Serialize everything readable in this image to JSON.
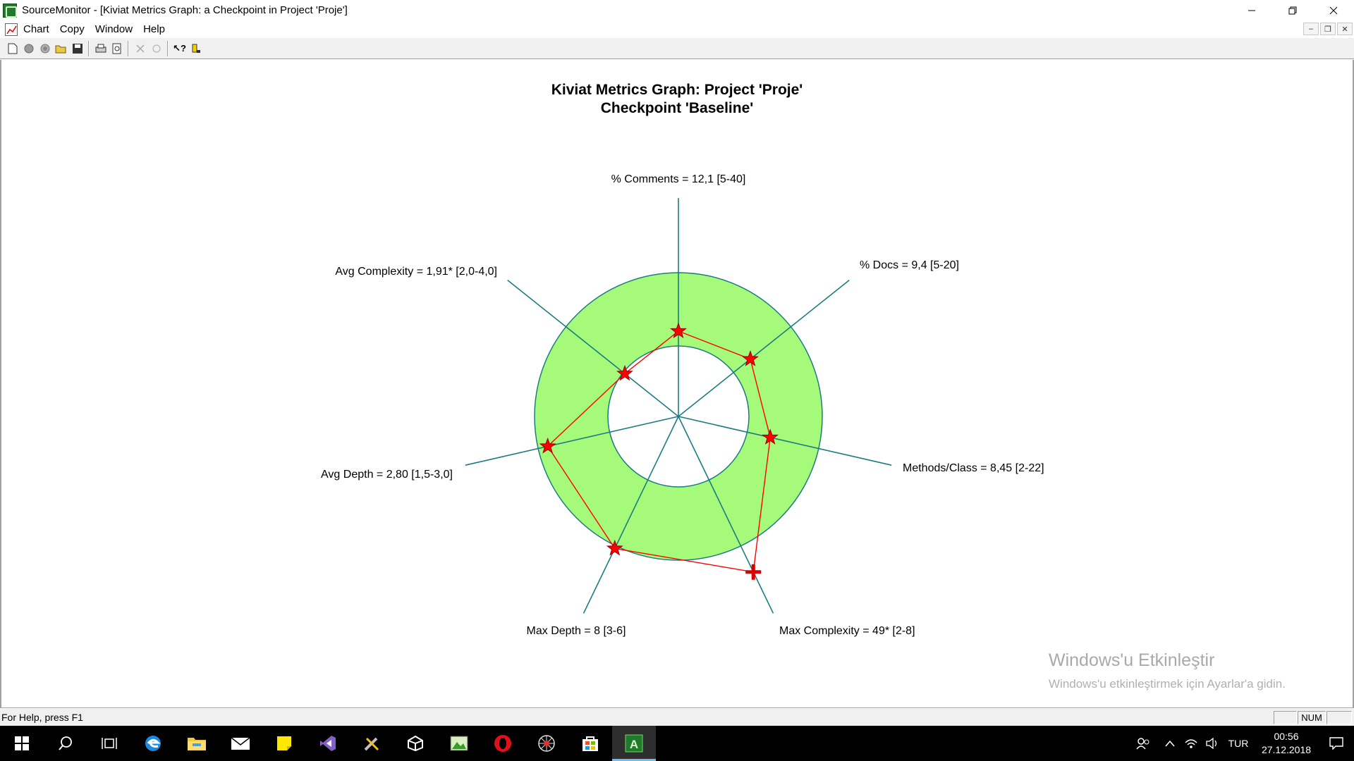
{
  "window": {
    "title": "SourceMonitor - [Kiviat Metrics Graph: a Checkpoint in Project 'Proje']",
    "icon": "sourcemonitor-app-icon",
    "controls": [
      "minimize-icon",
      "restore-icon",
      "close-icon"
    ]
  },
  "menu": {
    "items": [
      "Chart",
      "Copy",
      "Window",
      "Help"
    ],
    "mdi_controls": [
      "mdi-minimize-icon",
      "mdi-restore-icon",
      "mdi-close-icon"
    ]
  },
  "toolbar": {
    "buttons": [
      "new-icon",
      "project-icon",
      "checkpoint-icon",
      "open-icon",
      "save-icon",
      "print-icon",
      "print-preview-icon",
      "delete-icon",
      "refresh-icon",
      "context-help-icon",
      "about-icon"
    ]
  },
  "chart_data": {
    "type": "kiviat",
    "title_line1": "Kiviat Metrics Graph: Project 'Proje'",
    "title_line2": "Checkpoint 'Baseline'",
    "band_color": "#a6fa7a",
    "axis_color": "#1b7c82",
    "series_color": "#ff0000",
    "axes": [
      {
        "label": "% Comments = 12,1 [5-40]",
        "metric": "% Comments",
        "value": 12.1,
        "min": 5,
        "max": 40,
        "out_of_range": false
      },
      {
        "label": "% Docs = 9,4 [5-20]",
        "metric": "% Docs",
        "value": 9.4,
        "min": 5,
        "max": 20,
        "out_of_range": false
      },
      {
        "label": "Methods/Class = 8,45 [2-22]",
        "metric": "Methods/Class",
        "value": 8.45,
        "min": 2,
        "max": 22,
        "out_of_range": false
      },
      {
        "label": "Max Complexity = 49* [2-8]",
        "metric": "Max Complexity",
        "value": 49,
        "min": 2,
        "max": 8,
        "out_of_range": true
      },
      {
        "label": "Max Depth = 8 [3-6]",
        "metric": "Max Depth",
        "value": 8,
        "min": 3,
        "max": 6,
        "out_of_range": true
      },
      {
        "label": "Avg Depth = 2,80 [1,5-3,0]",
        "metric": "Avg Depth",
        "value": 2.8,
        "min": 1.5,
        "max": 3.0,
        "out_of_range": false
      },
      {
        "label": "Avg Complexity = 1,91* [2,0-4,0]",
        "metric": "Avg Complexity",
        "value": 1.91,
        "min": 2.0,
        "max": 4.0,
        "out_of_range": true
      }
    ]
  },
  "watermark": {
    "title": "Windows'u Etkinleştir",
    "subtitle": "Windows'u etkinleştirmek için Ayarlar'a gidin."
  },
  "status": {
    "help_text": "For Help, press F1",
    "num": "NUM"
  },
  "taskbar": {
    "apps": [
      "windows-start-icon",
      "search-icon",
      "task-view-icon",
      "edge-icon",
      "file-explorer-icon",
      "mail-icon",
      "sticky-notes-icon",
      "visual-studio-icon",
      "tools-icon",
      "unity-icon",
      "image-viewer-icon",
      "opera-icon",
      "web-icon",
      "store-icon",
      "sourcemonitor-taskbar-icon"
    ],
    "language": "TUR",
    "time": "00:56",
    "date": "27.12.2018"
  }
}
